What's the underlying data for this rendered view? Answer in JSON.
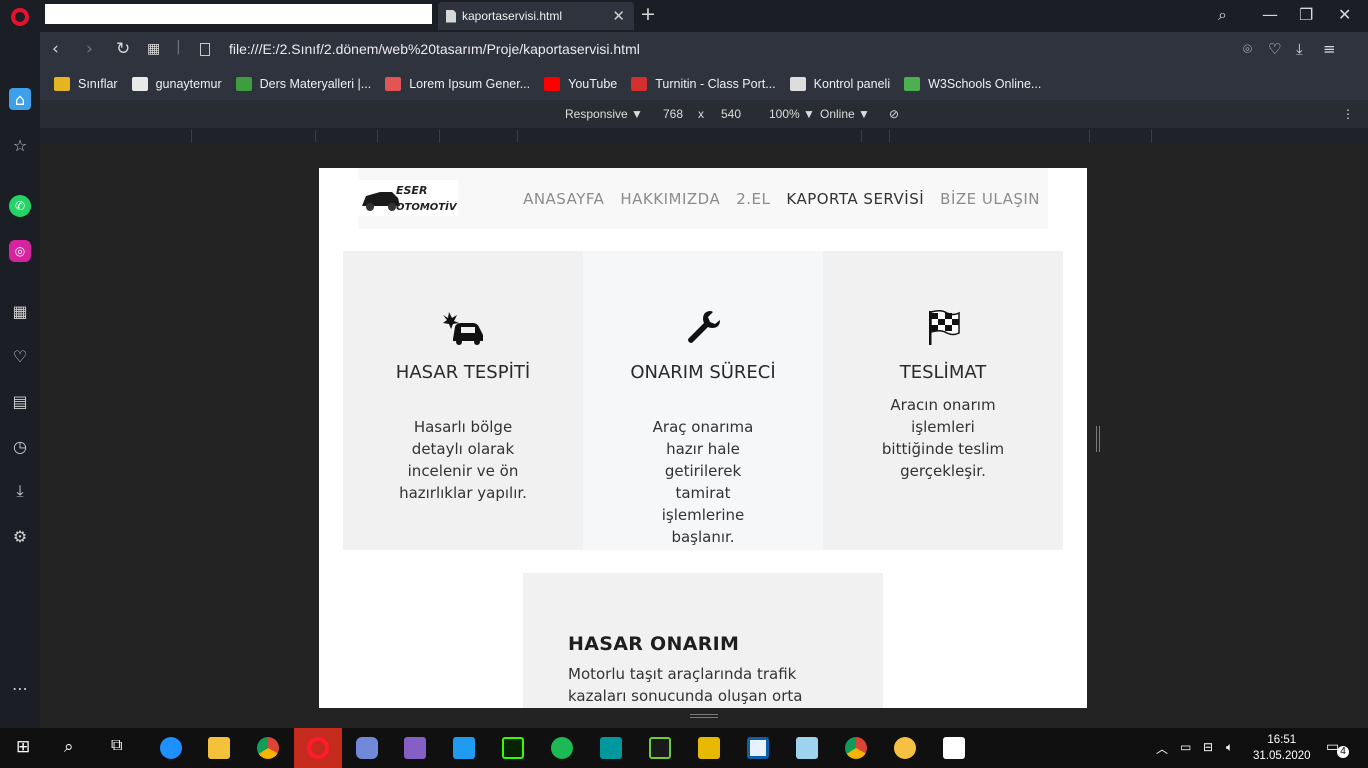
{
  "browser": {
    "tab_title": "kaportaservisi.html",
    "url": "file:///E:/2.Sınıf/2.dönem/web%20tasarım/Proje/kaportaservisi.html",
    "bookmarks": [
      {
        "label": "Sınıflar",
        "color": "#e5b521"
      },
      {
        "label": "gunaytemur",
        "color": "#e8e8e8"
      },
      {
        "label": "Ders Materyalleri |...",
        "color": "#3f9d3f"
      },
      {
        "label": "Lorem Ipsum Gener...",
        "color": "#e25555"
      },
      {
        "label": "YouTube",
        "color": "#ff0000"
      },
      {
        "label": "Turnitin - Class Port...",
        "color": "#d32f2f"
      },
      {
        "label": "Kontrol paneli",
        "color": "#dddddd"
      },
      {
        "label": "W3Schools Online...",
        "color": "#4caf50"
      }
    ],
    "devtools": {
      "mode": "Responsive ▼",
      "width": "768",
      "times": "x",
      "height": "540",
      "zoom": "100% ▼",
      "network": "Online ▼"
    }
  },
  "site": {
    "logo_text_line1": "ESER",
    "logo_text_line2": "OTOMOTİV",
    "nav": [
      "ANASAYFA",
      "HAKKIMIZDA",
      "2.EL",
      "KAPORTA SERVİSİ",
      "BİZE ULAŞIN"
    ],
    "active_nav": "KAPORTA SERVİSİ",
    "cards": [
      {
        "title": "HASAR TESPİTİ",
        "text": "Hasarlı bölge detaylı olarak incelenir ve ön hazırlıklar yapılır.",
        "icon": "car-crash-icon"
      },
      {
        "title": "ONARIM SÜRECİ",
        "text": "Araç onarıma hazır hale getirilerek tamirat işlemlerine başlanır.",
        "icon": "wrench-icon"
      },
      {
        "title": "TESLİMAT",
        "text": "Aracın onarım işlemleri bittiğinde teslim gerçekleşir.",
        "icon": "checkered-flag-icon"
      }
    ],
    "hasar_onarim": {
      "title": "HASAR ONARIM",
      "text": "Motorlu taşıt araçlarında trafik kazaları sonucunda oluşan orta"
    }
  },
  "taskbar": {
    "time": "16:51",
    "date": "31.05.2020",
    "notifications": "4"
  },
  "colors": {
    "accent_red": "#e8102c",
    "chrome_dark": "#1b1e25",
    "toolbar": "#2e333d"
  }
}
